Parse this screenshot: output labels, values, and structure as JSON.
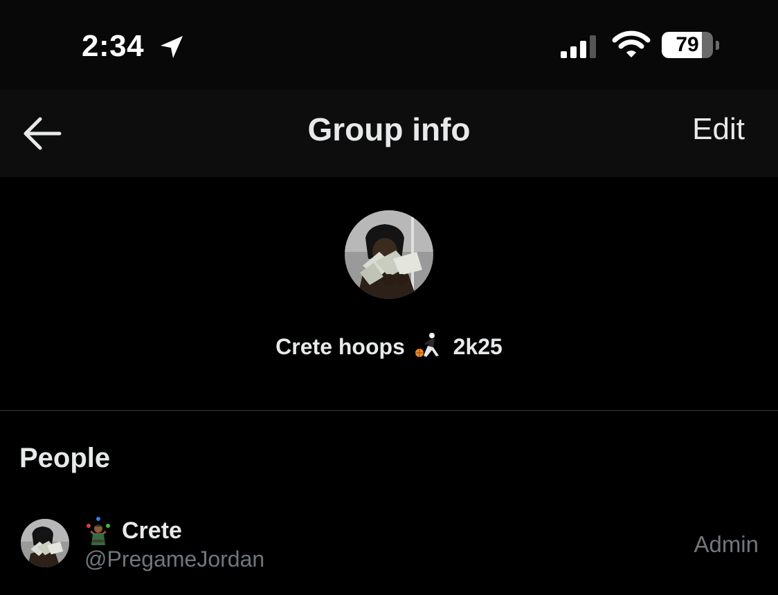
{
  "status_bar": {
    "time": "2:34",
    "battery_percent": 79,
    "battery_label": "79",
    "icons": [
      "location-arrow-icon",
      "cellular-signal-icon",
      "wifi-icon",
      "battery-icon"
    ]
  },
  "nav": {
    "back_icon": "arrow-left-icon",
    "title": "Group info",
    "edit_label": "Edit"
  },
  "group": {
    "name_part1": "Crete hoops",
    "name_emoji": "basketball-player-emoji",
    "name_part2": "2k25"
  },
  "people": {
    "section_title": "People",
    "members": [
      {
        "emoji": "juggling-person-emoji",
        "name": "Crete",
        "handle": "@PregameJordan",
        "role": "Admin"
      }
    ]
  },
  "colors": {
    "background": "#000000",
    "nav_background": "#0d0d0d",
    "primary_text": "#e7e9ea",
    "secondary_text": "#71767b",
    "divider": "#3a3a3a"
  }
}
